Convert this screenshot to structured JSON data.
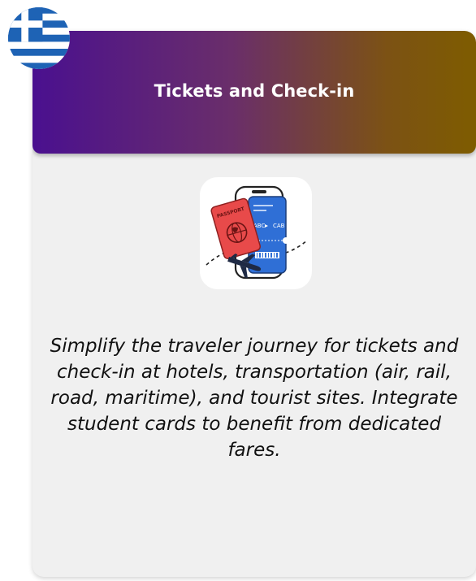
{
  "card": {
    "title": "Tickets and Check-in",
    "description": "Simplify the traveler journey for tickets and check-in at hotels, transportation (air, rail, road, maritime), and tourist sites. Integrate student cards to benefit from dedicated fares.",
    "colors": {
      "header_start": "#4a108f",
      "header_end": "#7e5c00",
      "body": "#f0f0f0"
    }
  },
  "flag": {
    "icon": "greece-flag-icon",
    "colors": {
      "blue": "#1e63b5",
      "white": "#ffffff"
    }
  },
  "illustration": {
    "icon": "passport-ticket-phone-icon",
    "passport_label": "PASSPORT",
    "ticket_from": "ABC",
    "ticket_to": "CAB"
  }
}
